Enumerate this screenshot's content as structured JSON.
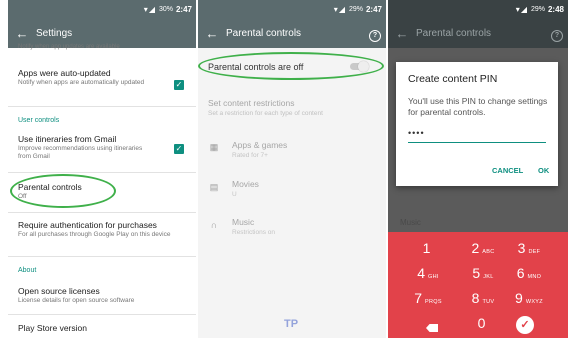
{
  "screen1": {
    "status": {
      "battery": "30%",
      "time": "2:47"
    },
    "title": "Settings",
    "cutoff_text": "Notify when app updates are available",
    "items": [
      {
        "title": "Apps were auto-updated",
        "subtitle": "Notify when apps are automatically updated",
        "checked": true
      },
      {
        "title": "Use itineraries from Gmail",
        "subtitle": "Improve recommendations using itineraries from Gmail",
        "checked": true
      },
      {
        "title": "Parental controls",
        "subtitle": "Off"
      },
      {
        "title": "Require authentication for purchases",
        "subtitle": "For all purchases through Google Play on this device"
      },
      {
        "title": "Open source licenses",
        "subtitle": "License details for open source software"
      },
      {
        "title": "Play Store version"
      }
    ],
    "sections": {
      "user_controls": "User controls",
      "about": "About"
    }
  },
  "screen2": {
    "status": {
      "battery": "29%",
      "time": "2:47"
    },
    "title": "Parental controls",
    "toggle_label": "Parental controls are off",
    "toggle_on": false,
    "restrictions_title": "Set content restrictions",
    "restrictions_subtitle": "Set a restriction for each type of content",
    "categories": [
      {
        "title": "Apps & games",
        "subtitle": "Rated for 7+",
        "icon": "apps-icon"
      },
      {
        "title": "Movies",
        "subtitle": "U",
        "icon": "movie-icon"
      },
      {
        "title": "Music",
        "subtitle": "Restrictions on",
        "icon": "headphones-icon"
      }
    ]
  },
  "screen3": {
    "status": {
      "battery": "29%",
      "time": "2:48"
    },
    "title": "Parental controls",
    "underlay_text": "Music",
    "dialog": {
      "title": "Create content PIN",
      "body": "You'll use this PIN to change settings for parental controls.",
      "pin_value": "••••",
      "cancel": "CANCEL",
      "ok": "OK"
    },
    "keys": [
      {
        "n": "1",
        "l": ""
      },
      {
        "n": "2",
        "l": "ABC"
      },
      {
        "n": "3",
        "l": "DEF"
      },
      {
        "n": "4",
        "l": "GHI"
      },
      {
        "n": "5",
        "l": "JKL"
      },
      {
        "n": "6",
        "l": "MNO"
      },
      {
        "n": "7",
        "l": "PRQS"
      },
      {
        "n": "8",
        "l": "TUV"
      },
      {
        "n": "9",
        "l": "WXYZ"
      },
      {
        "n": "0",
        "l": ""
      }
    ]
  },
  "colors": {
    "accent": "#0e8f80",
    "highlight": "#3fb04a",
    "keypad": "#e2424a",
    "appbar": "#5b6b6e"
  }
}
